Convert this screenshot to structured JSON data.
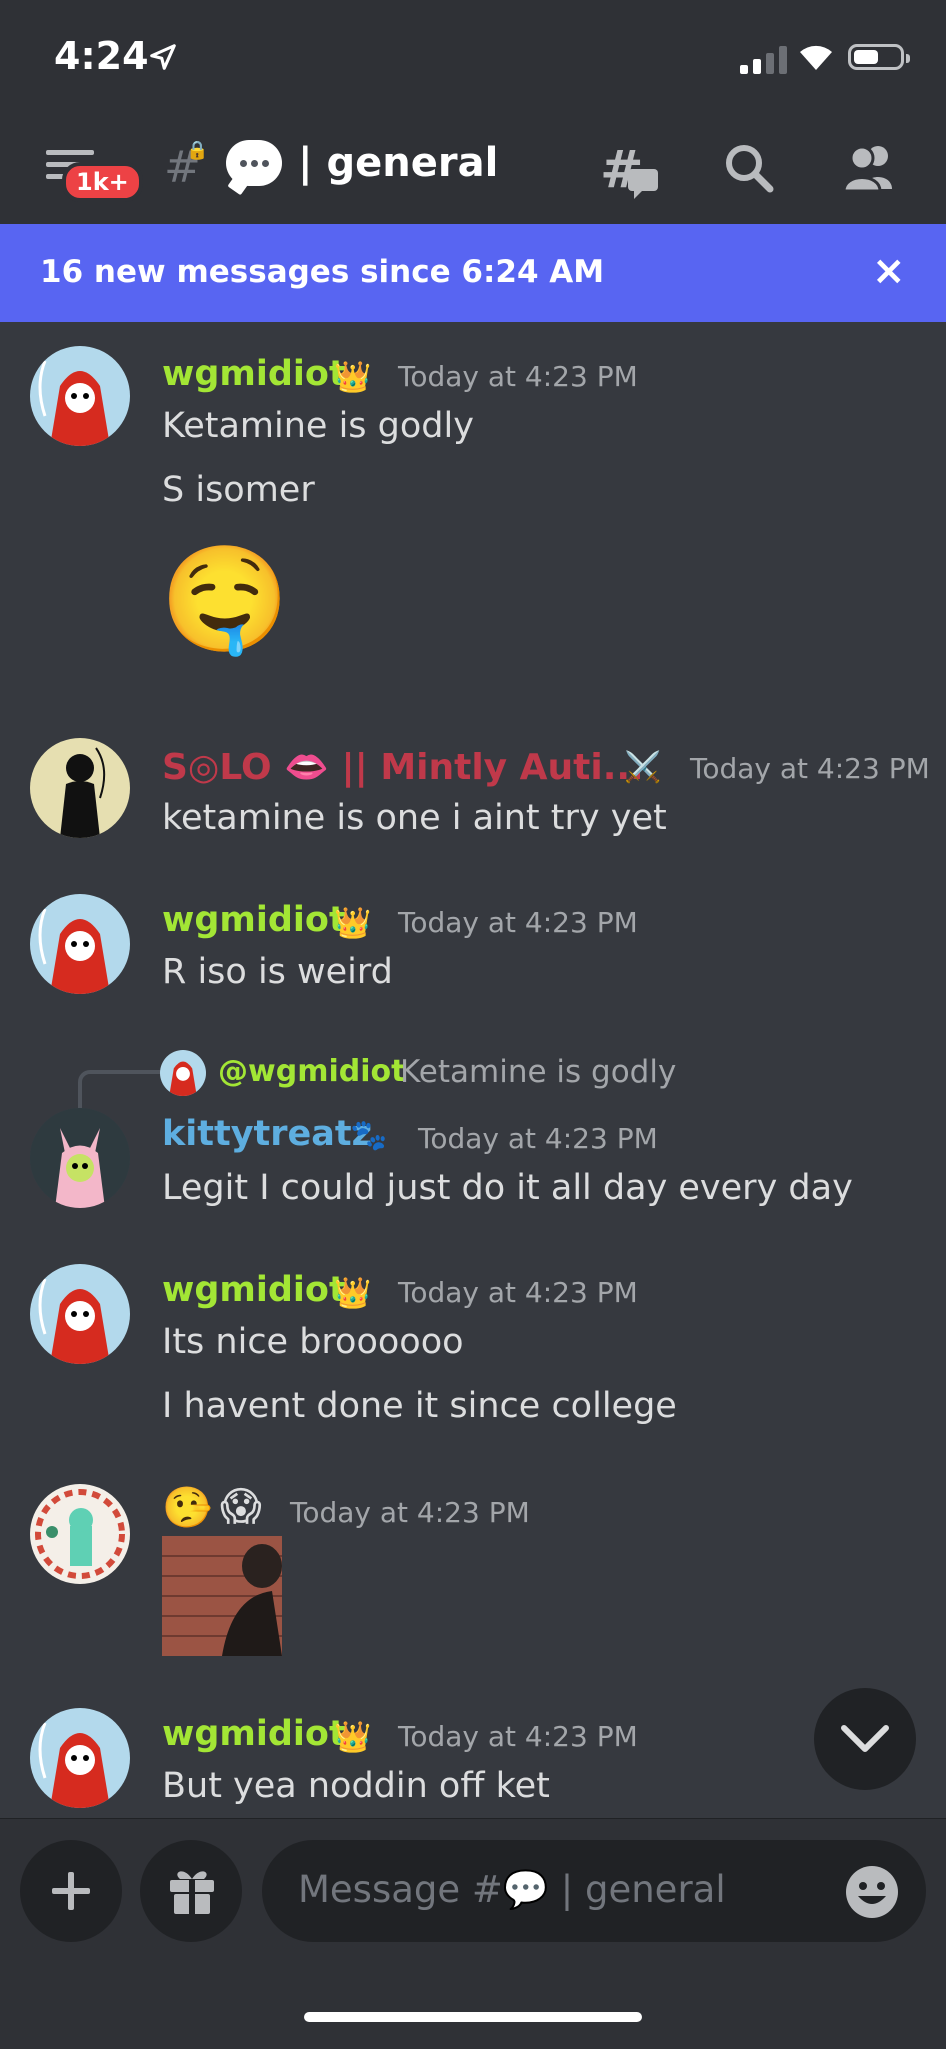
{
  "status_bar": {
    "time": "4:24"
  },
  "header": {
    "badge": "1k+",
    "channel_name": "| general"
  },
  "new_messages_bar": {
    "text": "16 new messages since 6:24 AM",
    "close_icon": "×"
  },
  "messages": [
    {
      "username": "wgmidiot",
      "user_color": "#a3e635",
      "badge_icon": "👑",
      "timestamp": "Today at 4:23 PM",
      "lines": [
        "Ketamine is godly",
        "S isomer"
      ],
      "emoji": "🤤"
    },
    {
      "username": "S◎LO 👄 || Mintly Auti...",
      "user_color": "#c0394a",
      "badge_icon": "⚔️",
      "timestamp": "Today at 4:23 PM",
      "lines": [
        "ketamine is one i aint try yet"
      ]
    },
    {
      "username": "wgmidiot",
      "user_color": "#a3e635",
      "badge_icon": "👑",
      "timestamp": "Today at 4:23 PM",
      "lines": [
        "R iso is weird"
      ]
    },
    {
      "reply_to_user": "@wgmidiot",
      "reply_to_text": "Ketamine is godly",
      "username": "kittytreatz",
      "user_color": "#5eaee0",
      "badge_icon": "🐾",
      "timestamp": "Today at 4:23 PM",
      "lines": [
        "Legit I could just do it all day every day"
      ]
    },
    {
      "username": "wgmidiot",
      "user_color": "#a3e635",
      "badge_icon": "👑",
      "timestamp": "Today at 4:23 PM",
      "lines": [
        "Its nice broooooo",
        "I havent done it since college"
      ]
    },
    {
      "username_emojis": [
        "🤥",
        "😱"
      ],
      "timestamp": "Today at 4:23 PM",
      "attachment": "image"
    },
    {
      "username": "wgmidiot",
      "user_color": "#a3e635",
      "badge_icon": "👑",
      "timestamp": "Today at 4:23 PM",
      "lines": [
        "But yea noddin off ket"
      ]
    }
  ],
  "composer": {
    "placeholder": "Message #💬 | general"
  }
}
